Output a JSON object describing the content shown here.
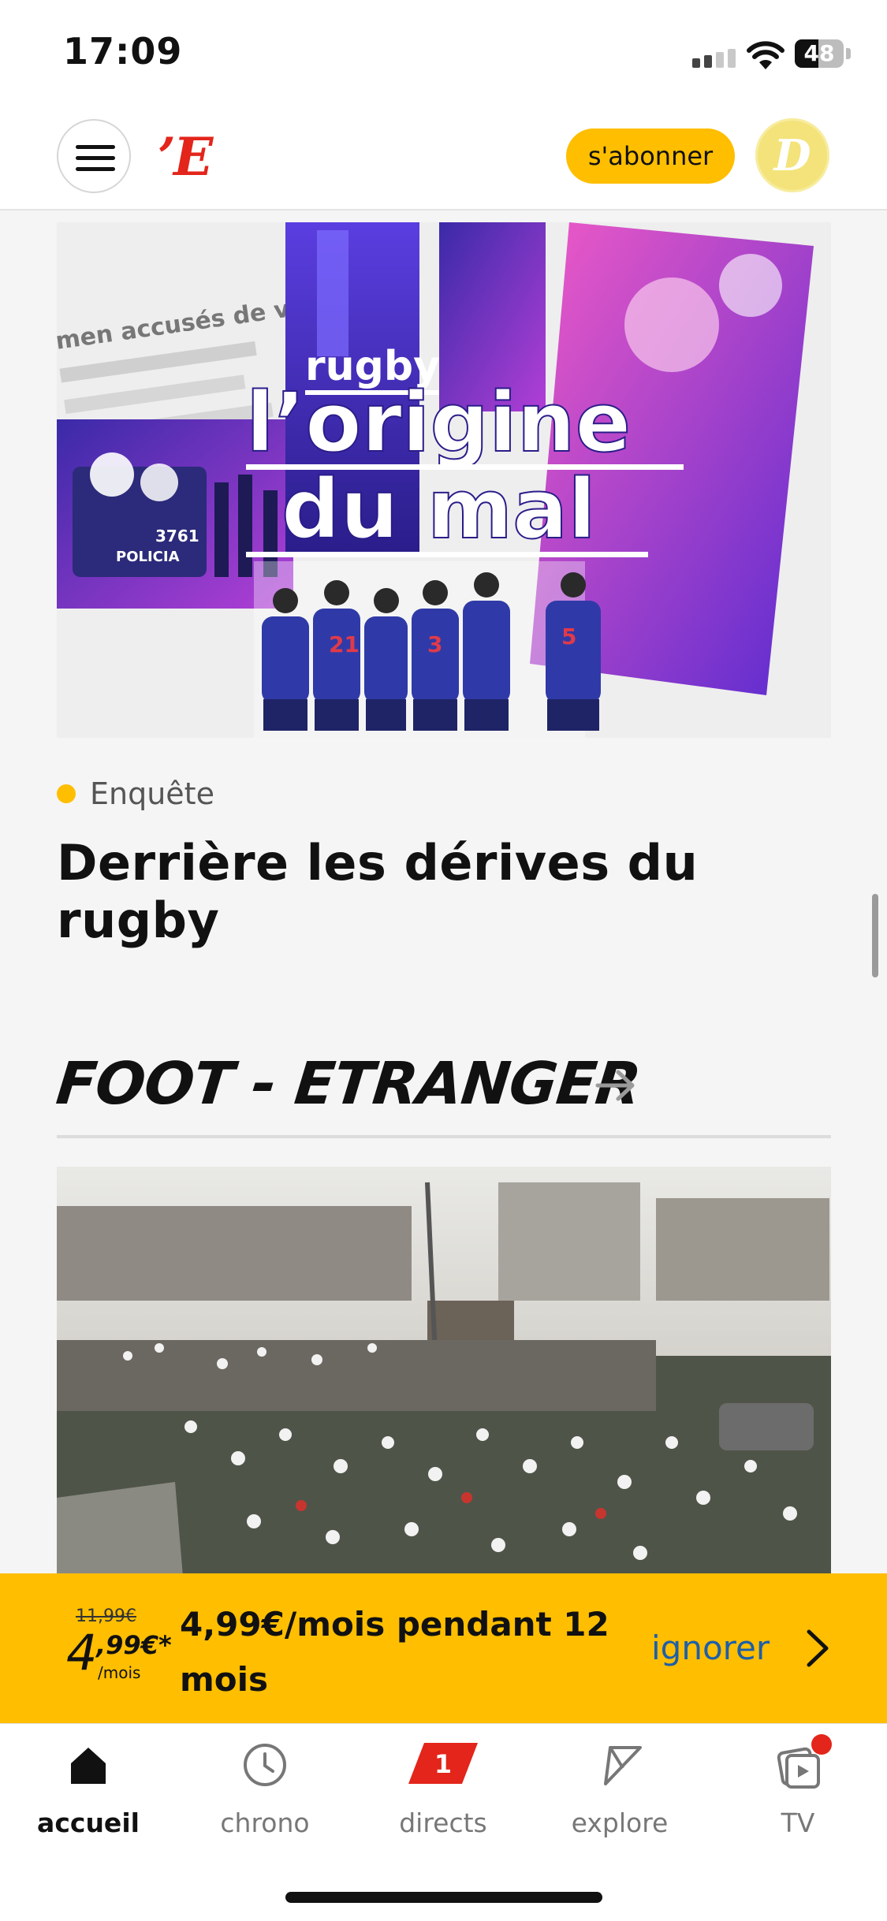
{
  "status_bar": {
    "time": "17:09",
    "battery": "48",
    "battery_level": 0.48
  },
  "header": {
    "logo": "’E",
    "subscribe_label": "s'abonner",
    "avatar_letter": "D"
  },
  "feature": {
    "image_title_small": "rugby",
    "image_title_line1": "l’origine",
    "image_title_line2": "du mal",
    "clipping_text": "men accusés de viol",
    "police_number": "3761",
    "police_word": "POLICIA",
    "tag": "Enquête",
    "headline": "Derrière les dérives du rugby"
  },
  "section": {
    "title": "FOOT - ETRANGER"
  },
  "promo": {
    "old_price": "11,99€",
    "price_int": "4",
    "price_dec": ",99€*",
    "price_unit": "/mois",
    "message": "4,99€/mois pendant 12 mois",
    "ignore_label": "ignorer"
  },
  "tabs": [
    {
      "label": "accueil",
      "icon": "home-icon",
      "active": true
    },
    {
      "label": "chrono",
      "icon": "clock-icon",
      "active": false
    },
    {
      "label": "directs",
      "icon": "live-flag-icon",
      "badge": "1",
      "active": false
    },
    {
      "label": "explore",
      "icon": "explore-icon",
      "active": false
    },
    {
      "label": "TV",
      "icon": "tv-icon",
      "active": false
    }
  ],
  "colors": {
    "accent": "#ffbe00",
    "logo_red": "#e3251b",
    "link_blue": "#1e5fa8"
  }
}
